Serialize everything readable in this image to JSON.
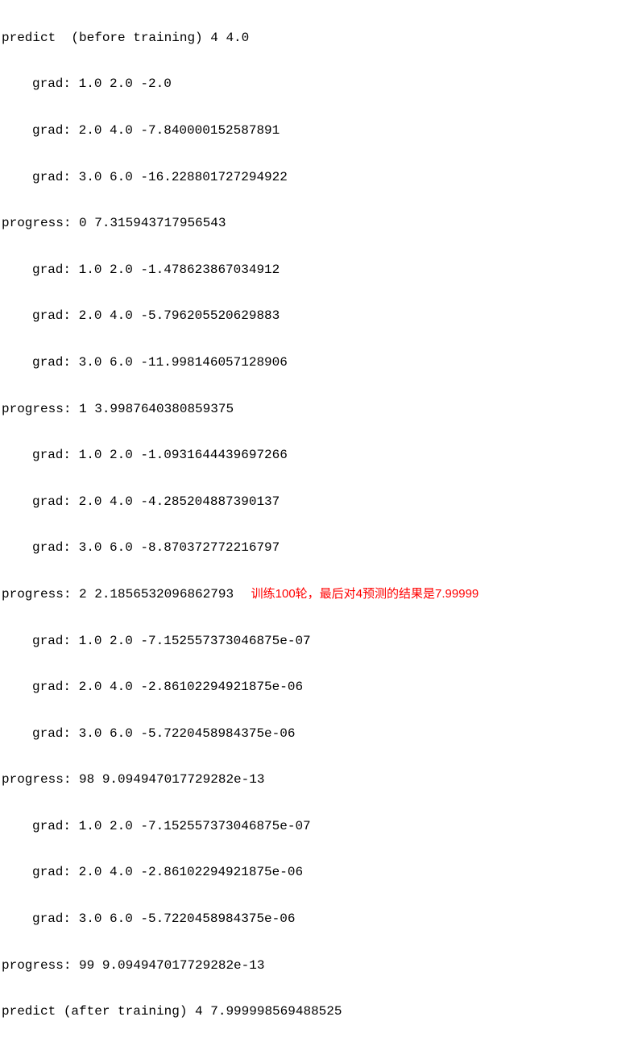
{
  "lines": {
    "l0": "predict  (before training) 4 4.0",
    "l1": "grad: 1.0 2.0 -2.0",
    "l2": "grad: 2.0 4.0 -7.840000152587891",
    "l3": "grad: 3.0 6.0 -16.228801727294922",
    "l4": "progress: 0 7.315943717956543",
    "l5": "grad: 1.0 2.0 -1.478623867034912",
    "l6": "grad: 2.0 4.0 -5.796205520629883",
    "l7": "grad: 3.0 6.0 -11.998146057128906",
    "l8": "progress: 1 3.9987640380859375",
    "l9": "grad: 1.0 2.0 -1.0931644439697266",
    "l10": "grad: 2.0 4.0 -4.285204887390137",
    "l11": "grad: 3.0 6.0 -8.870372772216797",
    "l12": "progress: 2 2.1856532096862793",
    "l13": "grad: 1.0 2.0 -7.152557373046875e-07",
    "l14": "grad: 2.0 4.0 -2.86102294921875e-06",
    "l15": "grad: 3.0 6.0 -5.7220458984375e-06",
    "l16": "progress: 98 9.094947017729282e-13",
    "l17": "grad: 1.0 2.0 -7.152557373046875e-07",
    "l18": "grad: 2.0 4.0 -2.86102294921875e-06",
    "l19": "grad: 3.0 6.0 -5.7220458984375e-06",
    "l20": "progress: 99 9.094947017729282e-13",
    "l21": "predict (after training) 4 7.999998569488525"
  },
  "annotation": "训练100轮，最后对4预测的结果是7.99999"
}
